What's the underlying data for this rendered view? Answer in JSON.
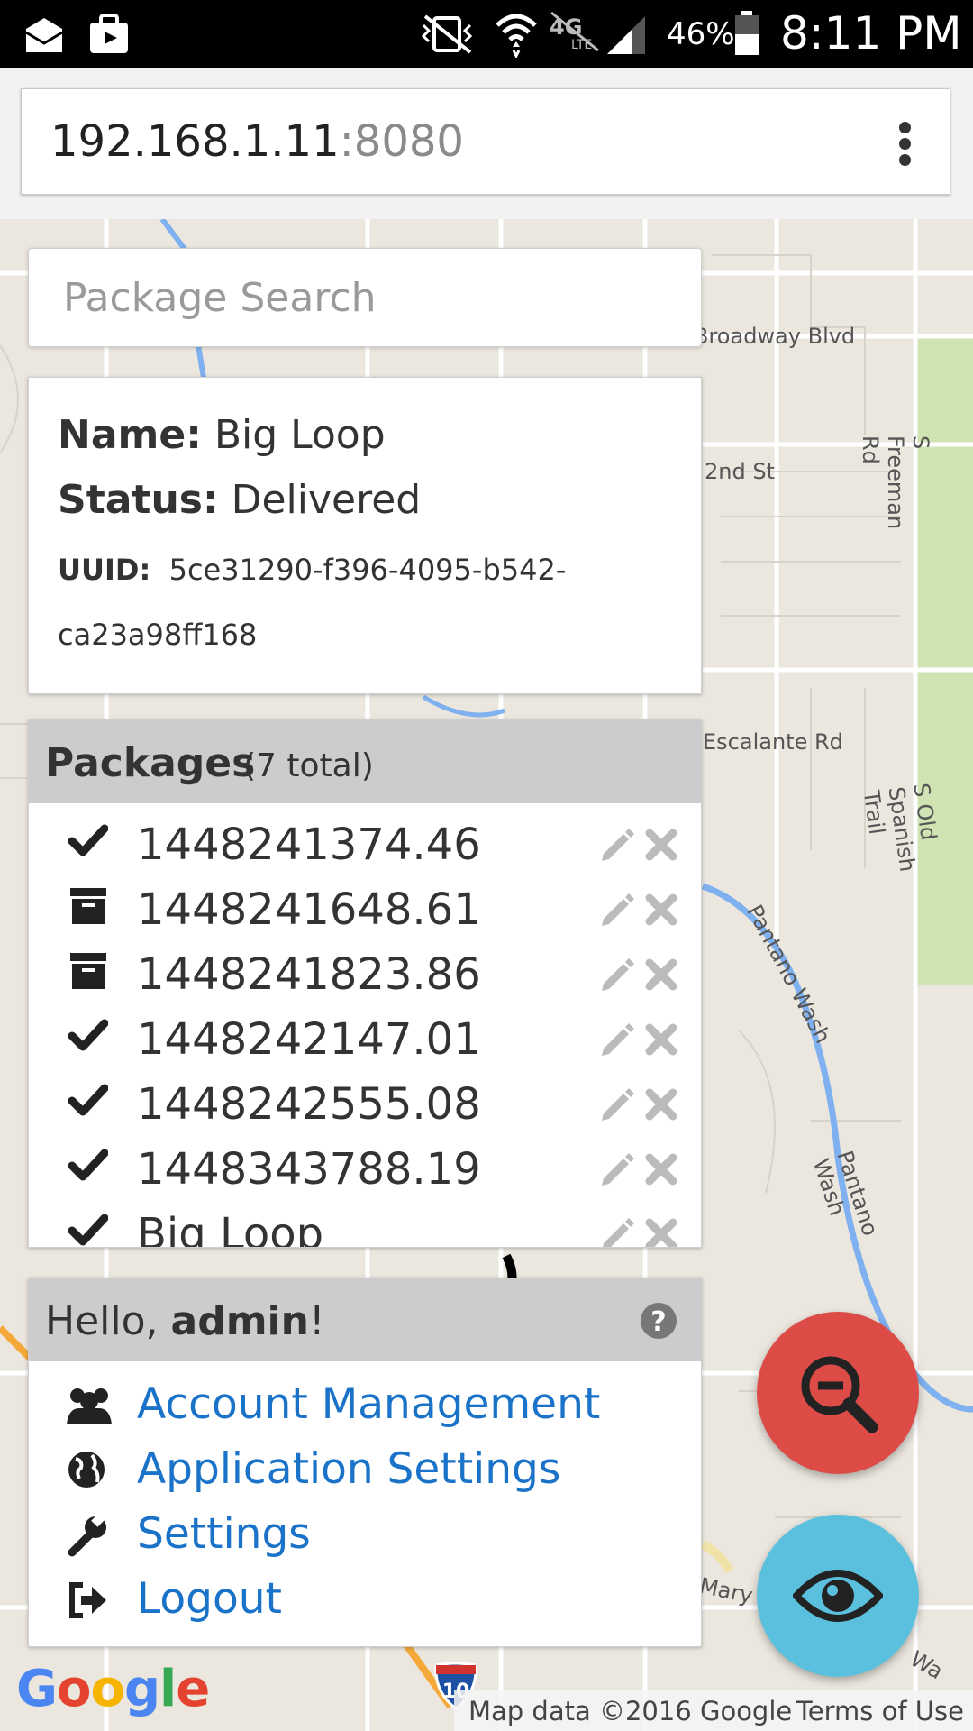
{
  "status_bar": {
    "battery_percent": "46%",
    "time": "8:11 PM",
    "icons": [
      "mail-icon",
      "store-icon",
      "vibrate-mute-icon",
      "wifi-icon",
      "4g-lte-icon",
      "signal-icon",
      "battery-icon"
    ]
  },
  "browser": {
    "url_host": "192.168.1.11",
    "url_port": ":8080",
    "menu_icon": "more-vert-icon"
  },
  "search": {
    "placeholder": "Package Search"
  },
  "info": {
    "name_label": "Name:",
    "name_value": "Big Loop",
    "status_label": "Status:",
    "status_value": "Delivered",
    "uuid_label": "UUID:",
    "uuid_value_line1": "5ce31290-f396-4095-b542-",
    "uuid_value_line2": "ca23a98ff168"
  },
  "packages": {
    "title": "Packages",
    "count_text": "(7 total)",
    "items": [
      {
        "name": "1448241374.46",
        "icon": "check-icon"
      },
      {
        "name": "1448241648.61",
        "icon": "archive-icon"
      },
      {
        "name": "1448241823.86",
        "icon": "archive-icon"
      },
      {
        "name": "1448242147.01",
        "icon": "check-icon"
      },
      {
        "name": "1448242555.08",
        "icon": "check-icon"
      },
      {
        "name": "1448343788.19",
        "icon": "check-icon"
      },
      {
        "name": "Big Loop",
        "icon": "check-icon"
      }
    ]
  },
  "user": {
    "greeting_prefix": "Hello, ",
    "username": "admin",
    "greeting_suffix": "!",
    "menu": [
      {
        "label": "Account Management",
        "icon": "users-icon"
      },
      {
        "label": "Application Settings",
        "icon": "globe-icon"
      },
      {
        "label": "Settings",
        "icon": "wrench-icon"
      },
      {
        "label": "Logout",
        "icon": "sign-out-icon"
      }
    ]
  },
  "map": {
    "labels": [
      "Broadway Blvd",
      "2nd St",
      "S Freeman Rd",
      "Escalante Rd",
      "S Old Spanish Trail",
      "Pantano Wash",
      "Pantano Wash",
      "Mary A",
      "Wa"
    ],
    "attribution": "Map data ©2016 Google",
    "terms": "Terms of Use",
    "logo": "Google",
    "shield": "10"
  },
  "fabs": {
    "zoom_out_color": "#dd4b47",
    "view_color": "#5bc0de"
  }
}
